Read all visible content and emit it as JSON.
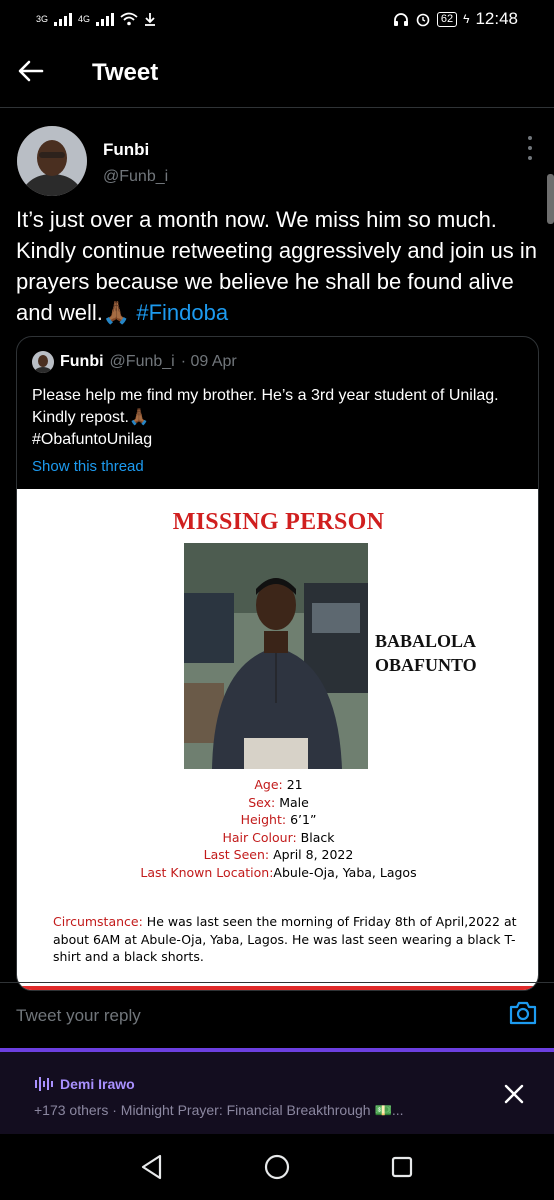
{
  "status_bar": {
    "network_1": "3G",
    "network_2": "4G",
    "battery": "62",
    "time": "12:48"
  },
  "header": {
    "title": "Tweet"
  },
  "tweet": {
    "author_name": "Funbi",
    "author_handle": "@Funb_i",
    "text": "It’s just over a month now. We miss him so much. Kindly continue retweeting aggressively and join us in prayers because we believe he shall be found alive and well.🙏🏾 ",
    "hashtag": "#Findoba"
  },
  "quote": {
    "author_name": "Funbi",
    "author_handle": "@Funb_i",
    "date": "· 09 Apr",
    "text": "Please help me find my brother. He’s a 3rd year student of Unilag. Kindly repost.🙏🏾",
    "hashtag": "#ObafuntoUnilag",
    "show_thread": "Show this thread"
  },
  "poster": {
    "title": "MISSING PERSON",
    "name_line1": "BABALOLA",
    "name_line2": "OBAFUNTO",
    "details": [
      {
        "label": "Age",
        "value": "21"
      },
      {
        "label": "Sex",
        "value": "Male"
      },
      {
        "label": "Height",
        "value": "6’1”"
      },
      {
        "label": "Hair Colour",
        "value": "Black"
      },
      {
        "label": "Last Seen",
        "value": "April 8, 2022"
      },
      {
        "label": "Last Known Location",
        "value": "Abule-Oja, Yaba, Lagos"
      }
    ],
    "circumstance_label": "Circumstance",
    "circumstance_text": "He was last seen the morning of Friday 8th of April,2022 at about 6AM at Abule-Oja, Yaba, Lagos. He was last seen wearing a black T-shirt and a black shorts."
  },
  "reply": {
    "placeholder": "Tweet your reply"
  },
  "spaces": {
    "host": "Demi Irawo",
    "description": "+173 others · Midnight Prayer: Financial Breakthrough 💵..."
  },
  "colors": {
    "accent": "#1d9bf0",
    "spaces_purple": "#6c3fe0",
    "poster_red": "#d01f1f"
  }
}
